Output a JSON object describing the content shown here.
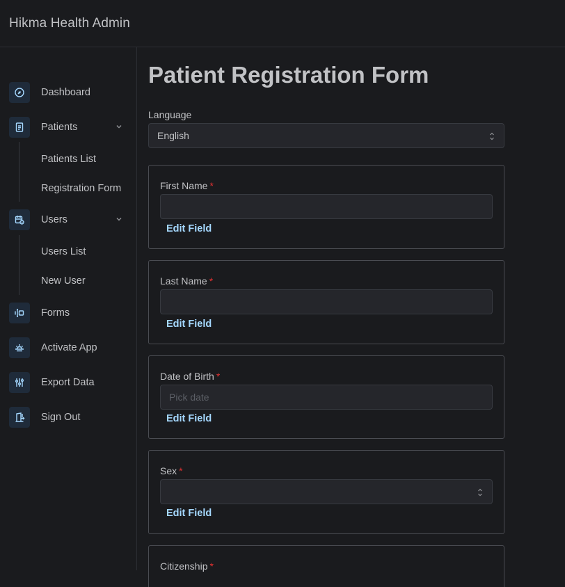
{
  "header": {
    "title": "Hikma Health Admin"
  },
  "sidebar": {
    "items": [
      {
        "label": "Dashboard",
        "icon": "gauge-icon"
      },
      {
        "label": "Patients",
        "icon": "notes-icon",
        "children": [
          "Patients List",
          "Registration Form"
        ]
      },
      {
        "label": "Users",
        "icon": "calendar-stats-icon",
        "children": [
          "Users List",
          "New User"
        ]
      },
      {
        "label": "Forms",
        "icon": "forms-icon"
      },
      {
        "label": "Activate App",
        "icon": "sunrise-icon"
      },
      {
        "label": "Export Data",
        "icon": "adjustments-icon"
      },
      {
        "label": "Sign Out",
        "icon": "door-exit-icon"
      }
    ]
  },
  "main": {
    "title": "Patient Registration Form",
    "language": {
      "label": "Language",
      "value": "English"
    },
    "fields": [
      {
        "label": "First Name",
        "required": "*",
        "value": "",
        "placeholder": "",
        "action": "Edit Field"
      },
      {
        "label": "Last Name",
        "required": "*",
        "value": "",
        "placeholder": "",
        "action": "Edit Field"
      },
      {
        "label": "Date of Birth",
        "required": "*",
        "value": "",
        "placeholder": "Pick date",
        "action": "Edit Field"
      },
      {
        "label": "Sex",
        "required": "*",
        "value": "",
        "placeholder": "",
        "action": "Edit Field"
      },
      {
        "label": "Citizenship",
        "required": "*"
      }
    ]
  },
  "colors": {
    "accent": "#a5d8ff",
    "required": "#e03131",
    "background": "#1a1b1e"
  }
}
